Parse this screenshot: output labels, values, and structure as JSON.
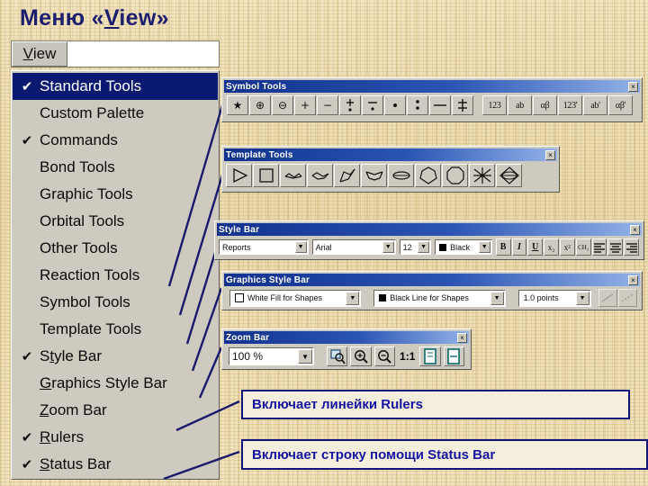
{
  "heading": {
    "ru": "Меню ",
    "open": "«",
    "en_before": "V",
    "en_rest": "iew",
    "close": "»"
  },
  "menubar": {
    "view_label_u": "V",
    "view_label_rest": "iew"
  },
  "menu": {
    "items": [
      {
        "label": "Standard Tools",
        "checked": true,
        "selected": true,
        "u": ""
      },
      {
        "label": "Custom Palette",
        "checked": false,
        "selected": false,
        "u": ""
      },
      {
        "label": "Commands",
        "checked": true,
        "selected": false,
        "u": ""
      },
      {
        "label": "Bond Tools",
        "checked": false,
        "selected": false,
        "u": ""
      },
      {
        "label": "Graphic Tools",
        "checked": false,
        "selected": false,
        "u": ""
      },
      {
        "label": "Orbital Tools",
        "checked": false,
        "selected": false,
        "u": ""
      },
      {
        "label": "Other Tools",
        "checked": false,
        "selected": false,
        "u": ""
      },
      {
        "label": "Reaction Tools",
        "checked": false,
        "selected": false,
        "u": ""
      },
      {
        "label": "Symbol Tools",
        "checked": false,
        "selected": false,
        "u": ""
      },
      {
        "label": "Template Tools",
        "checked": false,
        "selected": false,
        "u": ""
      },
      {
        "label": "Style Bar",
        "checked": true,
        "selected": false,
        "u": "t"
      },
      {
        "label": "Graphics Style Bar",
        "checked": false,
        "selected": false,
        "u": "G"
      },
      {
        "label": "Zoom Bar",
        "checked": false,
        "selected": false,
        "u": "Z"
      },
      {
        "label": "Rulers",
        "checked": true,
        "selected": false,
        "u": "R"
      },
      {
        "label": "Status Bar",
        "checked": true,
        "selected": false,
        "u": "S"
      }
    ],
    "check_glyph": "✔"
  },
  "symbol_tools": {
    "title": "Symbol Tools",
    "close": "×",
    "buttons": [
      {
        "icon": "star-icon",
        "glyph": "★"
      },
      {
        "icon": "circled-plus-icon",
        "glyph": "⊕"
      },
      {
        "icon": "circled-minus-icon",
        "glyph": "⊖"
      },
      {
        "icon": "plus-icon",
        "glyph": "+"
      },
      {
        "icon": "minus-icon",
        "glyph": "−"
      },
      {
        "icon": "plus-dot-icon",
        "glyph": "⁺."
      },
      {
        "icon": "minus-dot-icon",
        "glyph": "⁻."
      },
      {
        "icon": "single-dot-icon",
        "glyph": "•"
      },
      {
        "icon": "two-dots-icon",
        "glyph": "⁞"
      },
      {
        "icon": "line-icon",
        "glyph": "—"
      },
      {
        "icon": "double-dagger-icon",
        "glyph": "‡"
      }
    ],
    "label_buttons": [
      {
        "icon": "number-label-icon",
        "text": "123"
      },
      {
        "icon": "letter-label-icon",
        "text": "ab"
      },
      {
        "icon": "greek-label-icon",
        "text": "αβ"
      },
      {
        "icon": "number-label-prime-icon",
        "text": "123"
      },
      {
        "icon": "letter-label-prime-icon",
        "text": "ab"
      },
      {
        "icon": "greek-label-prime-icon",
        "text": "αβ"
      }
    ]
  },
  "template_tools": {
    "title": "Template Tools",
    "close": "×",
    "buttons": [
      {
        "icon": "triangle-template-icon"
      },
      {
        "icon": "square-template-icon"
      },
      {
        "icon": "cyclopentane-chair-template-icon"
      },
      {
        "icon": "cyclohexane-chair-template-icon"
      },
      {
        "icon": "zigzag-template-icon"
      },
      {
        "icon": "cyclohexane-boat-template-icon"
      },
      {
        "icon": "ellipse-ring-template-icon"
      },
      {
        "icon": "heptagon-template-icon"
      },
      {
        "icon": "octagon-template-icon"
      },
      {
        "icon": "newman-projection-template-icon"
      },
      {
        "icon": "fused-ring-template-icon"
      }
    ]
  },
  "style_bar": {
    "title": "Style Bar",
    "close": "×",
    "style_value": "Reports",
    "font_value": "Arial",
    "size_value": "12",
    "color_value": "Black",
    "arrow": "▼",
    "buttons": [
      {
        "icon": "bold-icon",
        "text": "B"
      },
      {
        "icon": "italic-icon",
        "text": "I"
      },
      {
        "icon": "underline-icon",
        "text": "U"
      },
      {
        "icon": "subscript-icon",
        "text": "x₂"
      },
      {
        "icon": "superscript-icon",
        "text": "x²"
      },
      {
        "icon": "formula-icon",
        "text": "CH₃"
      },
      {
        "icon": "align-left-icon",
        "text": ""
      },
      {
        "icon": "align-center-icon",
        "text": ""
      },
      {
        "icon": "align-right-icon",
        "text": ""
      }
    ]
  },
  "graphics_style_bar": {
    "title": "Graphics Style Bar",
    "close": "×",
    "fill_value": "White Fill for Shapes",
    "line_value": "Black Line for Shapes",
    "width_value": "1.0 points",
    "arrow": "▼",
    "extra_buttons": [
      {
        "icon": "line-style-icon"
      },
      {
        "icon": "dash-style-icon"
      }
    ]
  },
  "zoom_bar": {
    "title": "Zoom Bar",
    "close": "×",
    "zoom_value": "100 %",
    "arrow": "▼",
    "buttons": [
      {
        "icon": "zoom-selection-icon"
      },
      {
        "icon": "zoom-in-icon"
      },
      {
        "icon": "zoom-out-icon"
      },
      {
        "icon": "actual-size-icon",
        "text": "1:1"
      },
      {
        "icon": "fit-page-icon"
      },
      {
        "icon": "fit-width-icon"
      }
    ]
  },
  "callouts": [
    {
      "text": "Включает линейки Rulers"
    },
    {
      "text": "Включает строку помощи Status Bar"
    }
  ],
  "colors": {
    "title_blue": "#11318e",
    "menu_highlight": "#0a1a73",
    "callout_border": "#12127a",
    "callout_text": "#1414a0",
    "paper": "#ecdcb0",
    "toolbar_face": "#cecabf"
  }
}
